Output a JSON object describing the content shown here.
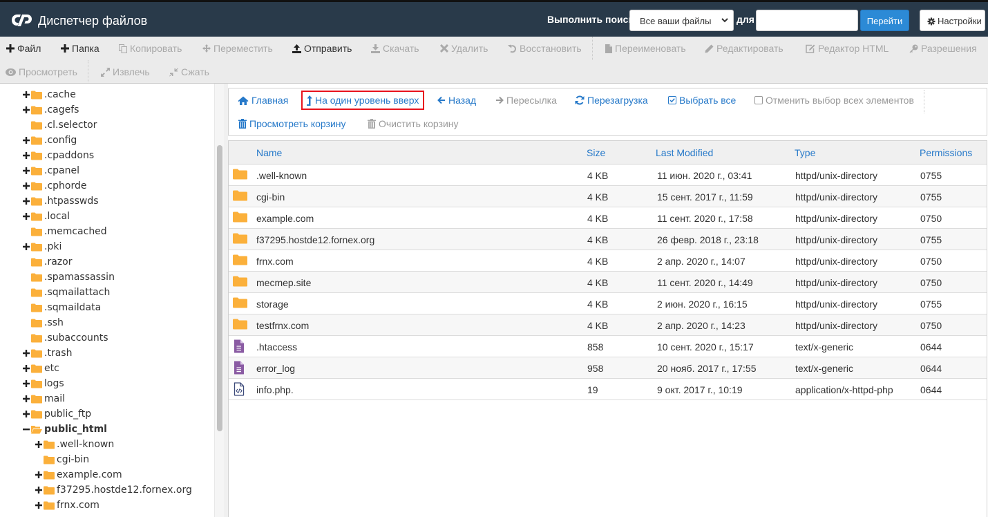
{
  "header": {
    "title": "Диспетчер файлов",
    "logo": "cpanel-logo",
    "search_label": "Выполнить поиск",
    "search_scope": "Все ваши файлы",
    "for_label": "для",
    "search_value": "",
    "go_label": "Перейти",
    "settings_label": "Настройки",
    "accent_color": "#2c8ad6",
    "header_bg": "#293a4a"
  },
  "toolbar": {
    "row1": [
      {
        "label": "Файл",
        "icon": "plus-icon",
        "enabled": true
      },
      {
        "label": "Папка",
        "icon": "plus-icon",
        "enabled": true
      },
      {
        "label": "Копировать",
        "icon": "copy-icon",
        "enabled": false
      },
      {
        "label": "Переместить",
        "icon": "move-icon",
        "enabled": false
      },
      {
        "label": "Отправить",
        "icon": "upload-icon",
        "enabled": true
      },
      {
        "label": "Скачать",
        "icon": "download-icon",
        "enabled": false
      },
      {
        "label": "Удалить",
        "icon": "close-icon",
        "enabled": false
      },
      {
        "label": "Восстановить",
        "icon": "undo-icon",
        "enabled": false
      },
      {
        "label": "Переименовать",
        "icon": "file-icon",
        "enabled": false
      },
      {
        "label": "Редактировать",
        "icon": "pencil-icon",
        "enabled": false
      },
      {
        "label": "Редактор HTML",
        "icon": "edit-square-icon",
        "enabled": false
      },
      {
        "label": "Разрешения",
        "icon": "key-icon",
        "enabled": false
      }
    ],
    "row2": [
      {
        "label": "Просмотреть",
        "icon": "eye-icon",
        "enabled": false
      },
      {
        "label": "Извлечь",
        "icon": "expand-icon",
        "enabled": false
      },
      {
        "label": "Сжать",
        "icon": "compress-icon",
        "enabled": false
      }
    ]
  },
  "tree": {
    "items": [
      {
        "label": ".cache",
        "expandable": true,
        "expanded": false,
        "level": 1
      },
      {
        "label": ".cagefs",
        "expandable": true,
        "expanded": false,
        "level": 1
      },
      {
        "label": ".cl.selector",
        "expandable": false,
        "expanded": false,
        "level": 1
      },
      {
        "label": ".config",
        "expandable": true,
        "expanded": false,
        "level": 1
      },
      {
        "label": ".cpaddons",
        "expandable": true,
        "expanded": false,
        "level": 1
      },
      {
        "label": ".cpanel",
        "expandable": true,
        "expanded": false,
        "level": 1
      },
      {
        "label": ".cphorde",
        "expandable": true,
        "expanded": false,
        "level": 1
      },
      {
        "label": ".htpasswds",
        "expandable": true,
        "expanded": false,
        "level": 1
      },
      {
        "label": ".local",
        "expandable": true,
        "expanded": false,
        "level": 1
      },
      {
        "label": ".memcached",
        "expandable": false,
        "expanded": false,
        "level": 1
      },
      {
        "label": ".pki",
        "expandable": true,
        "expanded": false,
        "level": 1
      },
      {
        "label": ".razor",
        "expandable": false,
        "expanded": false,
        "level": 1
      },
      {
        "label": ".spamassassin",
        "expandable": false,
        "expanded": false,
        "level": 1
      },
      {
        "label": ".sqmailattach",
        "expandable": false,
        "expanded": false,
        "level": 1
      },
      {
        "label": ".sqmaildata",
        "expandable": false,
        "expanded": false,
        "level": 1
      },
      {
        "label": ".ssh",
        "expandable": false,
        "expanded": false,
        "level": 1
      },
      {
        "label": ".subaccounts",
        "expandable": false,
        "expanded": false,
        "level": 1
      },
      {
        "label": ".trash",
        "expandable": true,
        "expanded": false,
        "level": 1
      },
      {
        "label": "etc",
        "expandable": true,
        "expanded": false,
        "level": 1
      },
      {
        "label": "logs",
        "expandable": true,
        "expanded": false,
        "level": 1
      },
      {
        "label": "mail",
        "expandable": true,
        "expanded": false,
        "level": 1
      },
      {
        "label": "public_ftp",
        "expandable": true,
        "expanded": false,
        "level": 1
      },
      {
        "label": "public_html",
        "expandable": true,
        "expanded": true,
        "level": 1,
        "current": true
      },
      {
        "label": ".well-known",
        "expandable": true,
        "expanded": false,
        "level": 2
      },
      {
        "label": "cgi-bin",
        "expandable": false,
        "expanded": false,
        "level": 2
      },
      {
        "label": "example.com",
        "expandable": true,
        "expanded": false,
        "level": 2
      },
      {
        "label": "f37295.hostde12.fornex.org",
        "expandable": true,
        "expanded": false,
        "level": 2
      },
      {
        "label": "frnx.com",
        "expandable": true,
        "expanded": false,
        "level": 2
      }
    ]
  },
  "nav": {
    "row1": [
      {
        "label": "Главная",
        "icon": "home-icon",
        "enabled": true
      },
      {
        "label": "На один уровень вверх",
        "icon": "level-up-icon",
        "enabled": true,
        "highlighted": true
      },
      {
        "label": "Назад",
        "icon": "arrow-left-icon",
        "enabled": true
      },
      {
        "label": "Пересылка",
        "icon": "arrow-right-icon",
        "enabled": false
      },
      {
        "label": "Перезагрузка",
        "icon": "refresh-icon",
        "enabled": true
      },
      {
        "label": "Выбрать все",
        "icon": "checkbox-checked-icon",
        "enabled": true
      },
      {
        "label": "Отменить выбор всех элементов",
        "icon": "checkbox-empty-icon",
        "enabled": false
      }
    ],
    "row2": [
      {
        "label": "Просмотреть корзину",
        "icon": "trash-icon",
        "enabled": true
      },
      {
        "label": "Очистить корзину",
        "icon": "trash-icon",
        "enabled": false
      }
    ],
    "highlight_color": "#e8121c"
  },
  "table": {
    "columns": [
      "Name",
      "Size",
      "Last Modified",
      "Type",
      "Permissions"
    ],
    "rows": [
      {
        "icon": "folder-icon",
        "name": ".well-known",
        "size": "4 KB",
        "modified": "11 июн. 2020 г., 03:41",
        "type": "httpd/unix-directory",
        "perms": "0755"
      },
      {
        "icon": "folder-icon",
        "name": "cgi-bin",
        "size": "4 KB",
        "modified": "15 сент. 2017 г., 11:59",
        "type": "httpd/unix-directory",
        "perms": "0755"
      },
      {
        "icon": "folder-icon",
        "name": "example.com",
        "size": "4 KB",
        "modified": "11 сент. 2020 г., 17:58",
        "type": "httpd/unix-directory",
        "perms": "0750"
      },
      {
        "icon": "folder-icon",
        "name": "f37295.hostde12.fornex.org",
        "size": "4 KB",
        "modified": "26 февр. 2018 г., 23:18",
        "type": "httpd/unix-directory",
        "perms": "0755"
      },
      {
        "icon": "folder-icon",
        "name": "frnx.com",
        "size": "4 KB",
        "modified": "2 апр. 2020 г., 14:07",
        "type": "httpd/unix-directory",
        "perms": "0750"
      },
      {
        "icon": "folder-icon",
        "name": "mecmep.site",
        "size": "4 KB",
        "modified": "11 сент. 2020 г., 14:49",
        "type": "httpd/unix-directory",
        "perms": "0750"
      },
      {
        "icon": "folder-icon",
        "name": "storage",
        "size": "4 KB",
        "modified": "2 июн. 2020 г., 16:15",
        "type": "httpd/unix-directory",
        "perms": "0755"
      },
      {
        "icon": "folder-icon",
        "name": "testfrnx.com",
        "size": "4 KB",
        "modified": "2 апр. 2020 г., 14:23",
        "type": "httpd/unix-directory",
        "perms": "0750"
      },
      {
        "icon": "text-file-icon",
        "name": ".htaccess",
        "size": "858",
        "modified": "10 сент. 2020 г., 15:17",
        "type": "text/x-generic",
        "perms": "0644"
      },
      {
        "icon": "text-file-icon",
        "name": "error_log",
        "size": "958",
        "modified": "20 нояб. 2017 г., 17:55",
        "type": "text/x-generic",
        "perms": "0644"
      },
      {
        "icon": "code-file-icon",
        "name": "info.php.",
        "size": "19",
        "modified": "9 окт. 2017 г., 10:19",
        "type": "application/x-httpd-php",
        "perms": "0644"
      }
    ]
  },
  "colors": {
    "folder": "#fbb03b",
    "text_file": "#8a5ba3",
    "code_file": "#3c4a7a",
    "link": "#2679c9"
  }
}
